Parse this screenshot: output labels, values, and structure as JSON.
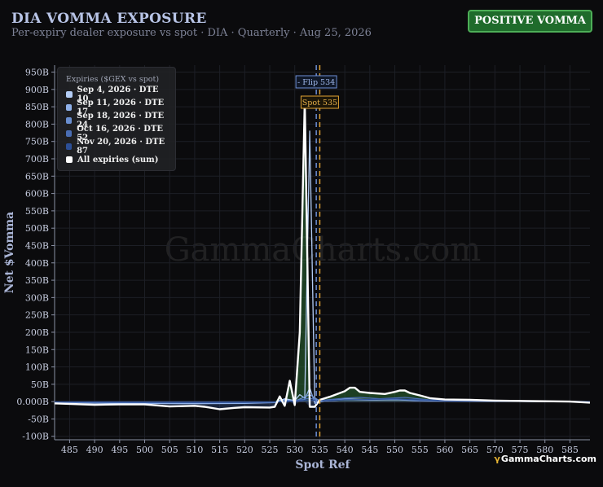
{
  "header": {
    "title": "DIA VOMMA EXPOSURE",
    "subtitle": "Per-expiry dealer exposure vs spot · DIA · Quarterly · Aug 25, 2026",
    "badge": "POSITIVE VOMMA"
  },
  "watermark": "GammaCharts.com",
  "brand": {
    "mark": "γ",
    "text": "GammaCharts.com"
  },
  "colors": {
    "background": "#0b0b0d",
    "axis_text": "#aab5d6",
    "badge_bg": "#1f6b2b",
    "flip_line": "#6d8fd6",
    "spot_line": "#e0a232",
    "positive_fill": "#2e6b36",
    "total_line": "#ffffff"
  },
  "legend": {
    "title": "Expiries ($GEX vs spot)",
    "items": [
      {
        "label": "Sep 4, 2026 · DTE 10",
        "color": "#b4cdf5"
      },
      {
        "label": "Sep 11, 2026 · DTE 17",
        "color": "#8fb1e9"
      },
      {
        "label": "Sep 18, 2026 · DTE 24",
        "color": "#6a8fd0"
      },
      {
        "label": "Oct 16, 2026 · DTE 52",
        "color": "#4a6eb4"
      },
      {
        "label": "Nov 20, 2026 · DTE 87",
        "color": "#2c4f96"
      },
      {
        "label": "All expiries (sum)",
        "color": "#ffffff"
      }
    ]
  },
  "chart_data": {
    "type": "line",
    "xlabel": "Spot Ref",
    "ylabel": "Net $Vomma",
    "xlim": [
      482,
      589
    ],
    "ylim": [
      -110,
      970
    ],
    "x_ticks": [
      485,
      490,
      495,
      500,
      505,
      510,
      515,
      520,
      525,
      530,
      535,
      540,
      545,
      550,
      555,
      560,
      565,
      570,
      575,
      580,
      585
    ],
    "y_ticks": [
      -100,
      -50,
      0,
      50,
      100,
      150,
      200,
      250,
      300,
      350,
      400,
      450,
      500,
      550,
      600,
      650,
      700,
      750,
      800,
      850,
      900,
      950
    ],
    "y_tick_labels": [
      "-100B",
      "-50B",
      "0.000B",
      "50B",
      "100B",
      "150B",
      "200B",
      "250B",
      "300B",
      "350B",
      "400B",
      "450B",
      "500B",
      "550B",
      "600B",
      "650B",
      "700B",
      "750B",
      "800B",
      "850B",
      "900B",
      "950B"
    ],
    "grid": true,
    "legend_position": "top-left",
    "series": [
      {
        "name": "Sep 4, 2026 · DTE 10",
        "x": [
          482,
          490,
          500,
          510,
          520,
          526,
          528,
          530,
          531,
          532,
          533,
          534,
          536,
          540,
          545,
          550,
          555,
          560,
          570,
          580,
          589
        ],
        "y": [
          -2,
          -3,
          -4,
          -5,
          -4,
          -2,
          8,
          3,
          20,
          10,
          780,
          -5,
          2,
          5,
          4,
          5,
          3,
          2,
          1,
          0,
          -1
        ]
      },
      {
        "name": "Sep 11, 2026 · DTE 17",
        "x": [
          482,
          490,
          500,
          510,
          520,
          526,
          528,
          530,
          532,
          533,
          534,
          536,
          540,
          545,
          550,
          555,
          560,
          570,
          580,
          589
        ],
        "y": [
          -2,
          -4,
          -5,
          -6,
          -5,
          -3,
          5,
          2,
          6,
          40,
          -4,
          3,
          8,
          6,
          7,
          4,
          2,
          1,
          0,
          -1
        ]
      },
      {
        "name": "Sep 18, 2026 · DTE 24",
        "x": [
          482,
          490,
          500,
          510,
          520,
          526,
          528,
          530,
          533,
          535,
          540,
          545,
          550,
          555,
          560,
          570,
          580,
          589
        ],
        "y": [
          -1,
          -2,
          -3,
          -3,
          -3,
          -2,
          4,
          1,
          20,
          2,
          6,
          5,
          6,
          3,
          2,
          1,
          0,
          -1
        ]
      },
      {
        "name": "Oct 16, 2026 · DTE 52",
        "x": [
          482,
          490,
          500,
          510,
          520,
          526,
          530,
          533,
          535,
          540,
          543,
          547,
          552,
          557,
          562,
          570,
          580,
          589
        ],
        "y": [
          -1,
          -2,
          -2,
          -3,
          -2,
          -1,
          2,
          10,
          3,
          10,
          12,
          8,
          12,
          5,
          3,
          2,
          1,
          0
        ]
      },
      {
        "name": "Nov 20, 2026 · DTE 87",
        "x": [
          482,
          490,
          500,
          510,
          520,
          526,
          530,
          533,
          535,
          540,
          545,
          550,
          555,
          560,
          570,
          580,
          589
        ],
        "y": [
          -1,
          -1,
          -2,
          -2,
          -2,
          -1,
          1,
          5,
          2,
          5,
          6,
          8,
          5,
          3,
          2,
          1,
          0
        ]
      },
      {
        "name": "All expiries (sum)",
        "x": [
          482,
          490,
          495,
          500,
          505,
          510,
          512,
          515,
          518,
          520,
          525,
          526,
          527,
          528,
          529,
          530,
          531,
          532,
          533,
          534,
          535,
          537,
          540,
          541,
          542,
          543,
          545,
          548,
          550,
          551,
          552,
          553,
          555,
          557,
          560,
          565,
          570,
          575,
          580,
          585,
          589
        ],
        "y": [
          -5,
          -9,
          -8,
          -8,
          -14,
          -12,
          -15,
          -22,
          -18,
          -16,
          -17,
          -15,
          15,
          -12,
          60,
          -10,
          200,
          870,
          -15,
          -15,
          5,
          14,
          30,
          40,
          40,
          28,
          25,
          22,
          28,
          32,
          32,
          25,
          18,
          10,
          6,
          5,
          3,
          2,
          1,
          0,
          -3
        ]
      }
    ],
    "annotations": [
      {
        "label": "- Flip 534",
        "x": 534.3
      },
      {
        "label": "Spot 535",
        "x": 535
      }
    ]
  }
}
